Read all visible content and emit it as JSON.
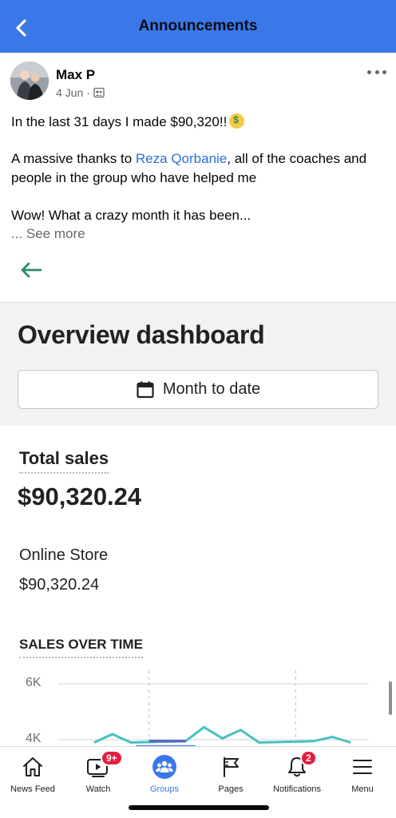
{
  "header": {
    "title": "Announcements",
    "back_icon": "chevron-left-icon"
  },
  "post": {
    "author": "Max P",
    "date": "4 Jun",
    "audience_icon": "group-icon",
    "line1": "In the last 31 days I made $90,320!!",
    "line1_emoji": "money-mouth-face-emoji",
    "line2_a": "A massive thanks to ",
    "mention": "Reza Qorbanie",
    "line2_b": ", all of the coaches and",
    "line3": "people in the group who have helped me",
    "line4": "Wow! What a crazy month it has been...",
    "see_more": "... See more"
  },
  "dashboard": {
    "title": "Overview dashboard",
    "date_range": "Month to date",
    "total_sales_label": "Total sales",
    "total_sales_value": "$90,320.24",
    "online_store_label": "Online Store",
    "online_store_value": "$90,320.24",
    "sales_over_time_label": "SALES OVER TIME"
  },
  "chart_data": {
    "type": "line",
    "title": "SALES OVER TIME",
    "y_ticks": [
      "6K",
      "4K"
    ],
    "ylim": [
      4000,
      6000
    ],
    "grid": true,
    "series": [
      {
        "color": "#47c1bf",
        "points": [
          [
            2,
            3900
          ],
          [
            3,
            4200
          ],
          [
            4,
            3900
          ],
          [
            7,
            3950
          ],
          [
            8,
            4450
          ],
          [
            9,
            4050
          ],
          [
            10,
            4350
          ],
          [
            11,
            3900
          ],
          [
            14,
            3950
          ],
          [
            15,
            4100
          ],
          [
            16,
            3900
          ]
        ]
      },
      {
        "color": "#5c6ac4",
        "points": [
          [
            5,
            3950
          ],
          [
            7,
            3950
          ]
        ]
      }
    ],
    "xlim": [
      0,
      17
    ]
  },
  "tabbar": {
    "tabs": [
      {
        "label": "News Feed",
        "icon": "home-icon",
        "badge": ""
      },
      {
        "label": "Watch",
        "icon": "video-icon",
        "badge": "9+"
      },
      {
        "label": "Groups",
        "icon": "groups-icon",
        "badge": ""
      },
      {
        "label": "Pages",
        "icon": "flag-icon",
        "badge": ""
      },
      {
        "label": "Notifications",
        "icon": "bell-icon",
        "badge": "2"
      },
      {
        "label": "Menu",
        "icon": "hamburger-menu-icon",
        "badge": ""
      }
    ],
    "active": "Groups",
    "colors": {
      "active": "#3b78e7",
      "badge": "#e41e3f"
    }
  }
}
